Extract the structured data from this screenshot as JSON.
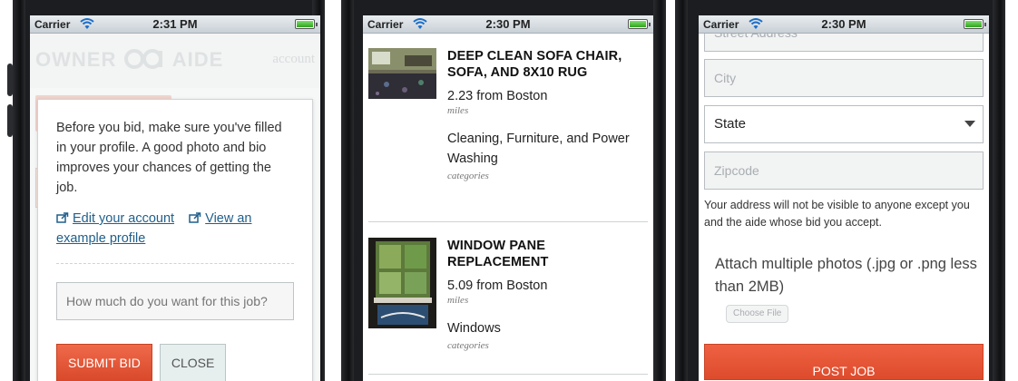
{
  "status_bars": [
    {
      "carrier": "Carrier",
      "time": "2:31 PM"
    },
    {
      "carrier": "Carrier",
      "time": "2:30 PM"
    },
    {
      "carrier": "Carrier",
      "time": "2:30 PM"
    }
  ],
  "screen1": {
    "logo_left": "OWNER",
    "logo_right": "AIDE",
    "account_link": "account",
    "modal": {
      "message": "Before you bid, make sure you've filled in your profile. A good photo and bio improves your chances of getting the job.",
      "edit_account_link": "Edit your account",
      "view_profile_link_line1": "View an",
      "view_profile_link_line2": "example profile",
      "bid_placeholder": "How much do you want for this job?",
      "submit_label": "SUBMIT BID",
      "close_label": "CLOSE"
    }
  },
  "screen2": {
    "jobs": [
      {
        "title": "DEEP CLEAN SOFA CHAIR, SOFA, AND 8X10 RUG",
        "distance": "2.23 from Boston",
        "distance_unit": "miles",
        "categories": "Cleaning, Furniture, and Power Washing",
        "categories_label": "categories"
      },
      {
        "title": "WINDOW PANE REPLACEMENT",
        "distance": "5.09 from Boston",
        "distance_unit": "miles",
        "categories": "Windows",
        "categories_label": "categories"
      }
    ]
  },
  "screen3": {
    "street_placeholder": "Street Address",
    "city_placeholder": "City",
    "state_value": "State",
    "zip_placeholder": "Zipcode",
    "address_note": "Your address will not be visible to anyone except you and the aide whose bid you accept.",
    "attach_text": "Attach multiple photos (.jpg or .png less than 2MB)",
    "choose_file_label": "Choose File",
    "post_job_label": "POST JOB"
  },
  "colors": {
    "accent_orange": "#dd4b2c",
    "link_blue": "#1f5f8b"
  }
}
